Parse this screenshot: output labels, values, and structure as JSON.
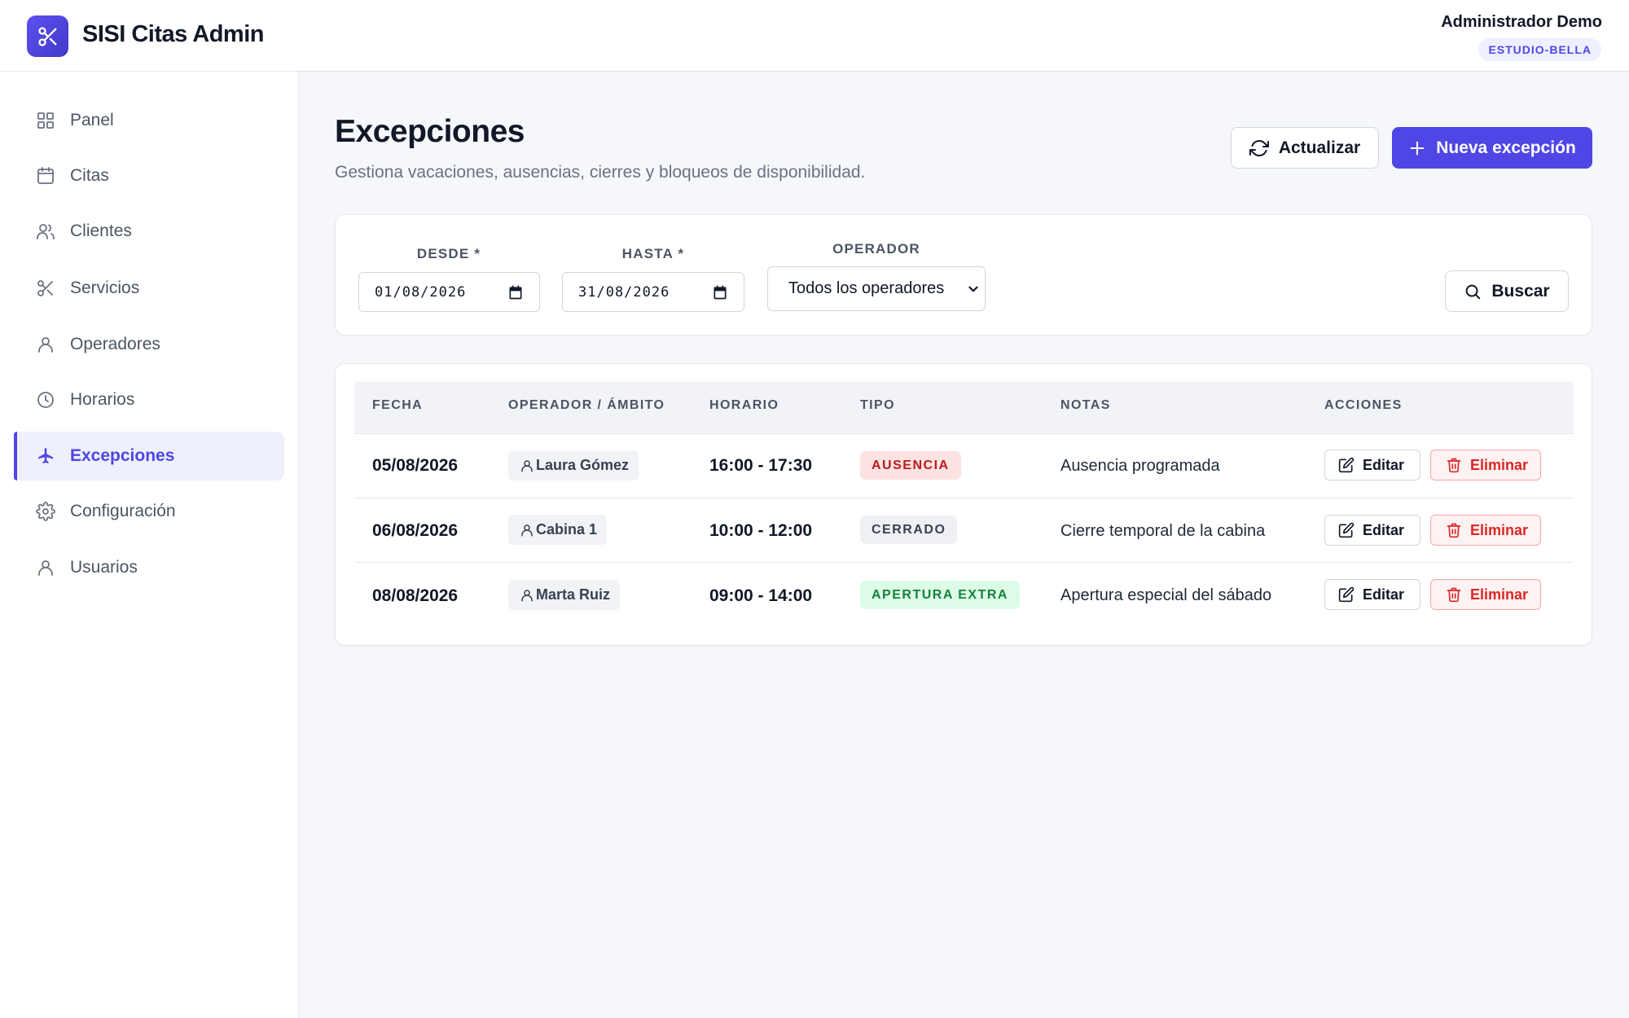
{
  "app": {
    "title": "SISI Citas Admin",
    "logo_icon": "scissors-icon",
    "accent": "#4f46e5"
  },
  "user": {
    "name": "Administrador Demo",
    "tenant": "ESTUDIO-BELLA"
  },
  "sidebar": {
    "items": [
      {
        "label": "Panel",
        "icon": "grid-icon",
        "active": false
      },
      {
        "label": "Citas",
        "icon": "calendar-icon",
        "active": false
      },
      {
        "label": "Clientes",
        "icon": "users-icon",
        "active": false
      },
      {
        "label": "Servicios",
        "icon": "scissors-icon",
        "active": false
      },
      {
        "label": "Operadores",
        "icon": "user-icon",
        "active": false
      },
      {
        "label": "Horarios",
        "icon": "clock-icon",
        "active": false
      },
      {
        "label": "Excepciones",
        "icon": "plane-icon",
        "active": true
      },
      {
        "label": "Configuración",
        "icon": "gear-icon",
        "active": false
      },
      {
        "label": "Usuarios",
        "icon": "user-icon",
        "active": false
      }
    ]
  },
  "page": {
    "title": "Excepciones",
    "subtitle": "Gestiona vacaciones, ausencias, cierres y bloqueos de disponibilidad.",
    "refresh_label": "Actualizar",
    "new_label": "Nueva excepción"
  },
  "filters": {
    "from_label": "DESDE *",
    "from_value": "01/08/2026",
    "to_label": "HASTA *",
    "to_value": "31/08/2026",
    "operator_label": "OPERADOR",
    "operator_value": "Todos los operadores",
    "search_label": "Buscar"
  },
  "table": {
    "headers": [
      "FECHA",
      "OPERADOR / ÁMBITO",
      "HORARIO",
      "TIPO",
      "NOTAS",
      "ACCIONES"
    ],
    "edit_label": "Editar",
    "delete_label": "Eliminar",
    "rows": [
      {
        "date": "05/08/2026",
        "operator": "Laura Gómez",
        "time": "16:00 - 17:30",
        "type": "AUSENCIA",
        "type_bg": "#fde2e2",
        "type_color": "#b91c1c",
        "note": "Ausencia programada"
      },
      {
        "date": "06/08/2026",
        "operator": "Cabina 1",
        "time": "10:00 - 12:00",
        "type": "CERRADO",
        "type_bg": "#eef0f3",
        "type_color": "#374151",
        "note": "Cierre temporal de la cabina"
      },
      {
        "date": "08/08/2026",
        "operator": "Marta Ruiz",
        "time": "09:00 - 14:00",
        "type": "APERTURA EXTRA",
        "type_bg": "#dcfce7",
        "type_color": "#15803d",
        "note": "Apertura especial del sábado"
      }
    ]
  }
}
